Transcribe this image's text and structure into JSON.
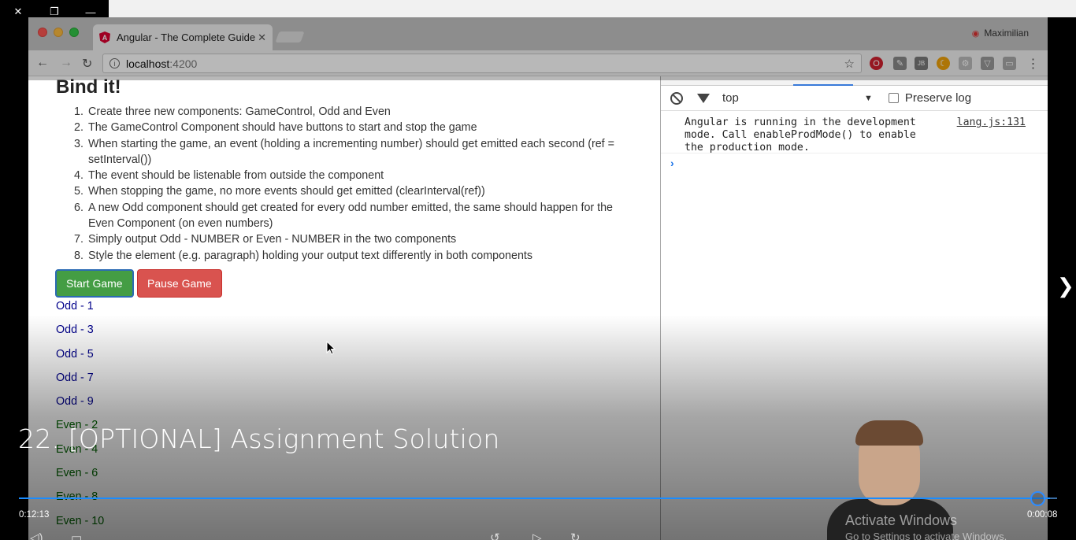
{
  "browser": {
    "tab_title": "Angular - The Complete Guide",
    "profile_name": "Maximilian",
    "url_host": "localhost",
    "url_port": ":4200"
  },
  "page": {
    "heading": "Bind it!",
    "steps": [
      {
        "num": "1.",
        "text": "Create three new components: GameControl, Odd and Even"
      },
      {
        "num": "2.",
        "text": "The GameControl Component should have buttons to start and stop the game"
      },
      {
        "num": "3.",
        "text": "When starting the game, an event (holding a incrementing number) should get emitted each second (ref = setInterval())"
      },
      {
        "num": "4.",
        "text": "The event should be listenable from outside the component"
      },
      {
        "num": "5.",
        "text": "When stopping the game, no more events should get emitted (clearInterval(ref))"
      },
      {
        "num": "6.",
        "text": "A new Odd component should get created for every odd number emitted, the same should happen for the Even Component (on even numbers)"
      },
      {
        "num": "7.",
        "text": "Simply output Odd - NUMBER or Even - NUMBER in the two components"
      },
      {
        "num": "8.",
        "text": "Style the element (e.g. paragraph) holding your output text differently in both components"
      }
    ],
    "start_label": "Start Game",
    "pause_label": "Pause Game",
    "odd_outputs": [
      "Odd - 1",
      "Odd - 3",
      "Odd - 5",
      "Odd - 7",
      "Odd - 9"
    ],
    "even_outputs": [
      "Even - 2",
      "Even - 4",
      "Even - 6",
      "Even - 8",
      "Even - 10"
    ]
  },
  "devtools": {
    "context": "top",
    "preserve_log": "Preserve log",
    "message": "Angular is running in the development mode. Call enableProdMode() to enable the production mode.",
    "source": "lang.js:131"
  },
  "player": {
    "title": "22. [OPTIONAL] Assignment Solution",
    "elapsed": "0:12:13",
    "remaining": "0:00:08",
    "progress_fraction": 0.993,
    "watermark": "Activate Windows",
    "watermark_sub": "Go to Settings to activate Windows."
  },
  "colors": {
    "odd": "#00008b",
    "even": "#006400",
    "start": "#449d44",
    "pause": "#d9534f",
    "seek": "#1a8cff"
  }
}
